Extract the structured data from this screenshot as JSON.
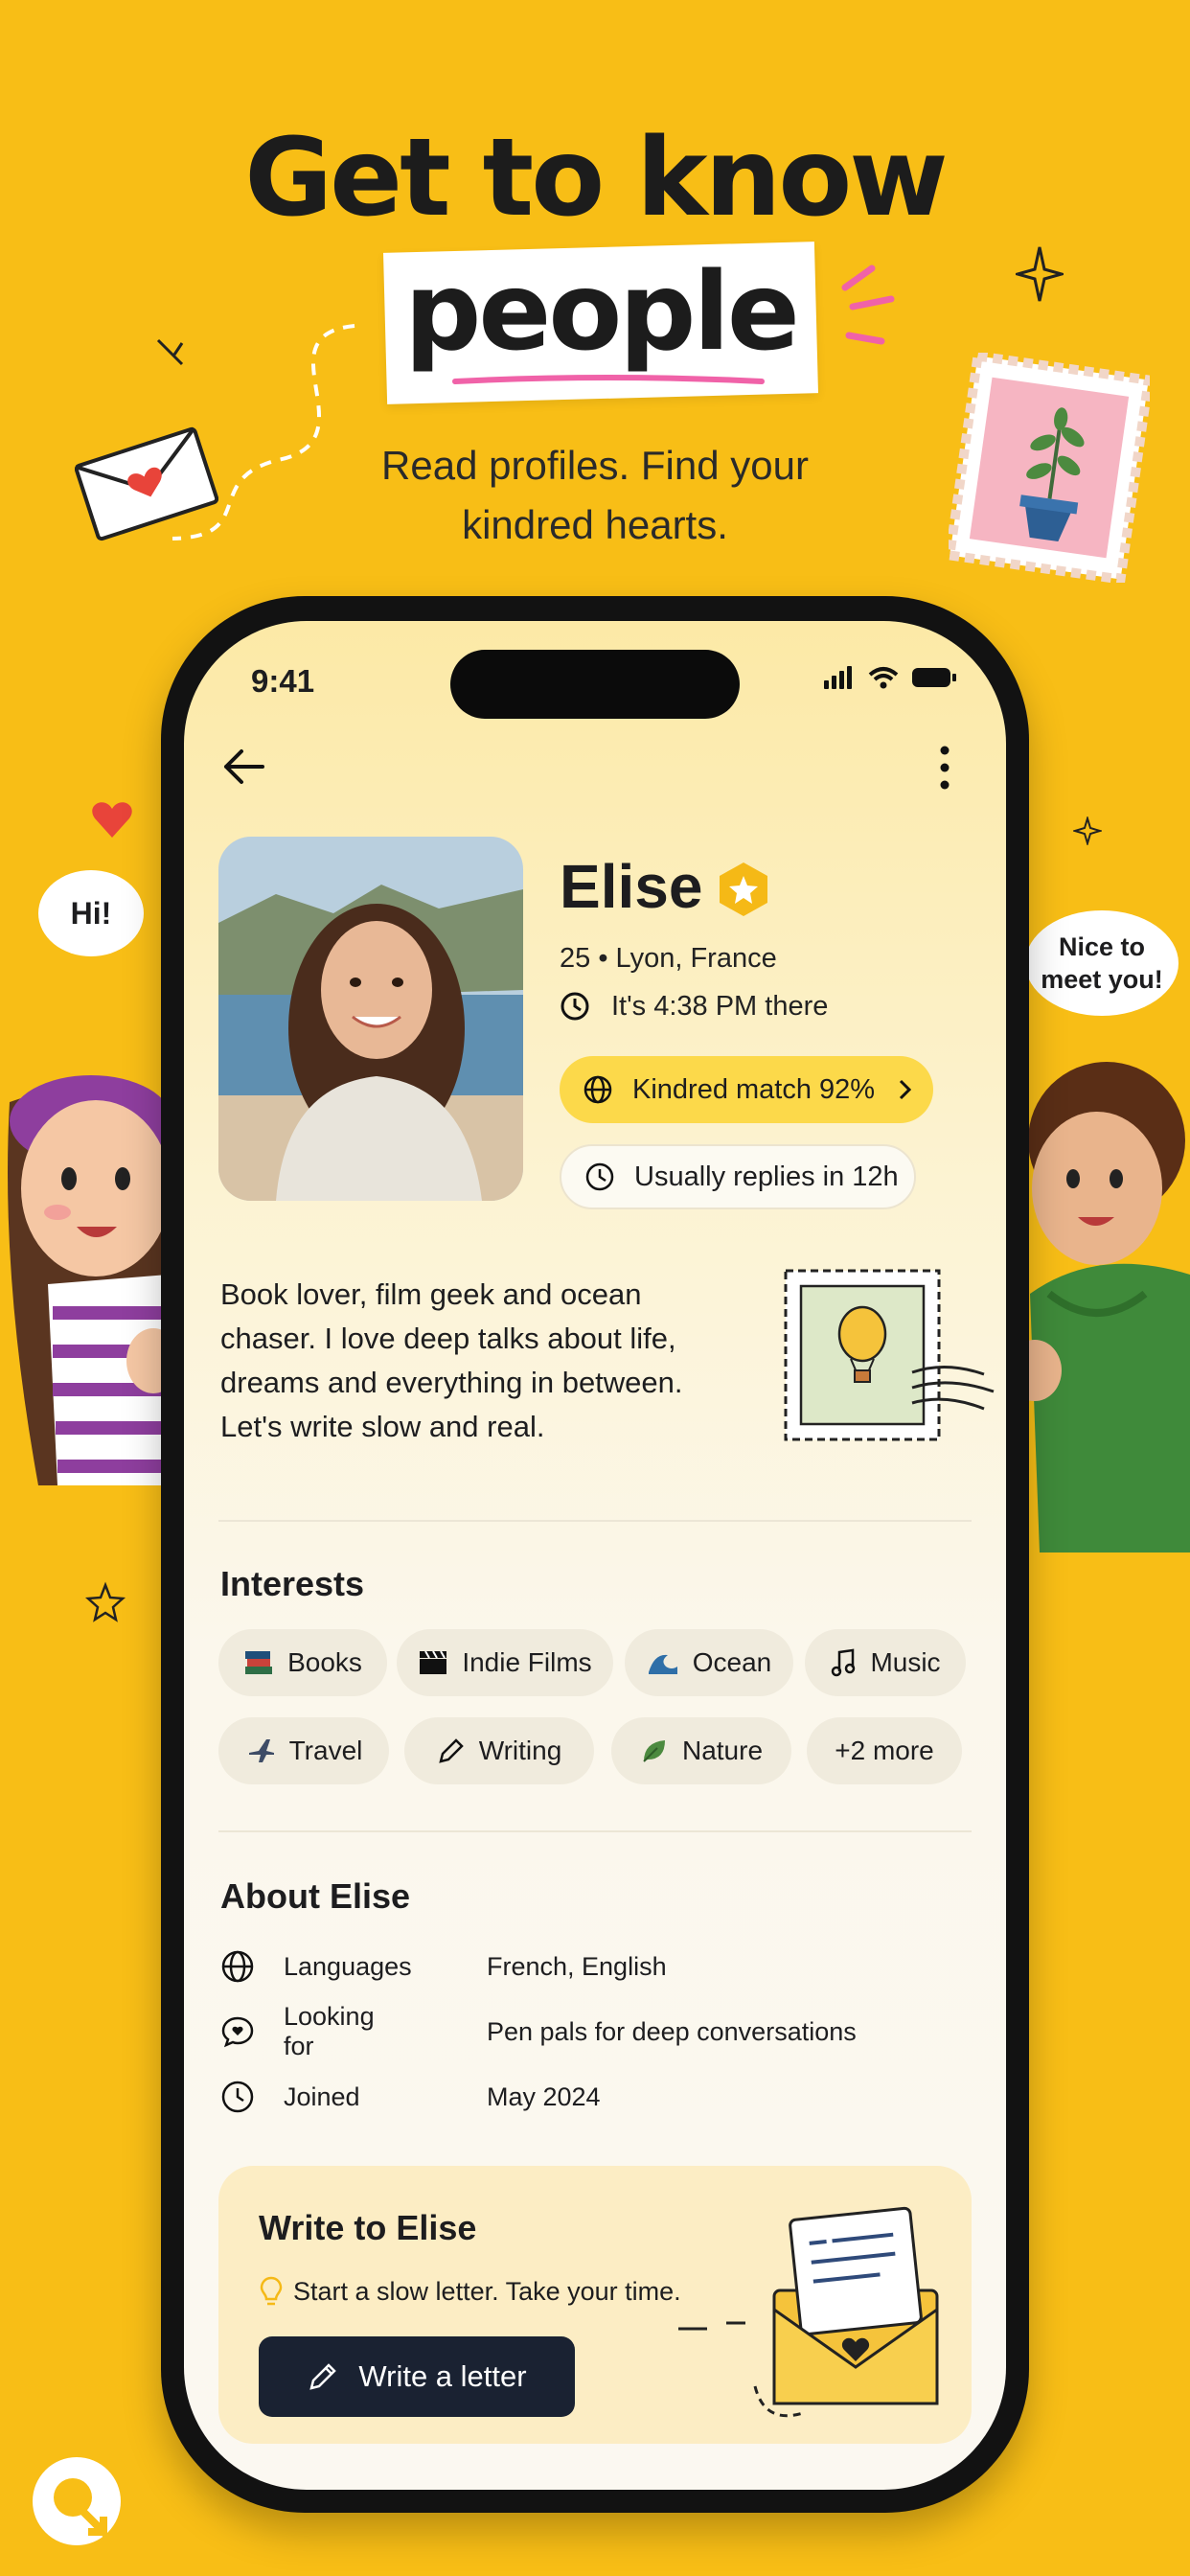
{
  "hero": {
    "headline": "Get to know",
    "highlight_word": "people",
    "subhead_line1": "Read profiles. Find your",
    "subhead_line2": "kindred hearts."
  },
  "speech_bubbles": {
    "left": "Hi!",
    "right_line1": "Nice to",
    "right_line2": "meet you!"
  },
  "status_bar": {
    "time": "9:41"
  },
  "profile": {
    "name": "Elise",
    "age_location": "25 • Lyon, France",
    "local_time": "It's 4:38 PM there",
    "match": "Kindred match 92%",
    "reply_time": "Usually replies in 12h",
    "bio_lines": [
      "Book lover, film geek and ocean",
      "chaser. I love deep talks about life,",
      "dreams and everything in between.",
      "Let's write slow and real."
    ]
  },
  "interests": {
    "title": "Interests",
    "chips": [
      {
        "label": "Books",
        "icon": "books-icon"
      },
      {
        "label": "Indie Films",
        "icon": "clapperboard-icon"
      },
      {
        "label": "Ocean",
        "icon": "wave-icon"
      },
      {
        "label": "Music",
        "icon": "music-note-icon"
      },
      {
        "label": "Travel",
        "icon": "airplane-icon"
      },
      {
        "label": "Writing",
        "icon": "pencil-icon"
      },
      {
        "label": "Nature",
        "icon": "leaf-icon"
      },
      {
        "label": "+2 more",
        "icon": ""
      }
    ]
  },
  "about": {
    "title": "About Elise",
    "rows": [
      {
        "key": "Languages",
        "value": "French, English",
        "icon": "globe-icon"
      },
      {
        "key": "Looking for",
        "value": "Pen pals for deep conversations",
        "icon": "chat-heart-icon"
      },
      {
        "key": "Joined",
        "value": "May 2024",
        "icon": "clock-icon"
      }
    ]
  },
  "write": {
    "title": "Write to Elise",
    "subtitle": "Start a slow letter. Take your time.",
    "button": "Write a letter"
  },
  "colors": {
    "background": "#F8BE16",
    "match_pill": "#FCD94A",
    "button_dark": "#1A2232",
    "accent_pink": "#F062A8"
  }
}
